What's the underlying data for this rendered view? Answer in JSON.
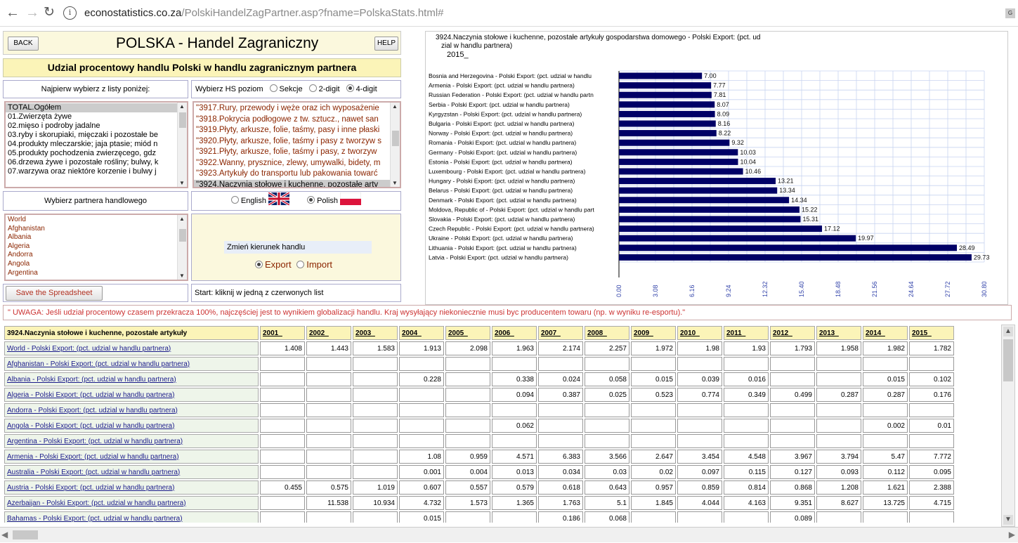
{
  "browser": {
    "url_domain": "econostatistics.co.za",
    "url_path": "/PolskiHandelZagPartner.asp?fname=PolskaStats.html#"
  },
  "header": {
    "back_label": "BACK",
    "title": "POLSKA - Handel Zagraniczny",
    "help_label": "HELP",
    "subtitle": "Udzial procentowy handlu Polski w handlu zagranicznym partnera"
  },
  "selectors": {
    "first_label": "Najpierw wybierz z listy poniżej:",
    "hs_label": "Wybierz HS poziom",
    "hs_options": [
      "Sekcje",
      "2-digit",
      "4-digit"
    ],
    "hs_selected": "4-digit",
    "product_list": [
      "TOTAL.Ogółem",
      "01.Zwierzęta żywe",
      "02.mięso i podroby jadalne",
      "03.ryby i skorupiaki, mięczaki i pozostałe be",
      "04.produkty mleczarskie; jaja ptasie; miód n",
      "05.produkty pochodzenia zwierzęcego, gdz",
      "06.drzewa żywe i pozostałe rośliny; bulwy, k",
      "07.warzywa oraz niektóre korzenie i bulwy j"
    ],
    "hs_list": [
      "\"3917.Rury, przewody i węże oraz ich wyposażenie",
      "\"3918.Pokrycia podłogowe z tw. sztucz., nawet san",
      "\"3919.Płyty, arkusze, folie, taśmy, pasy i inne płaski",
      "\"3920.Płyty, arkusze, folie, taśmy i pasy z tworzyw s",
      "\"3921.Płyty, arkusze, folie, taśmy i pasy, z tworzyw",
      "\"3922.Wanny, prysznice, zlewy, umywalki, bidety, m",
      "\"3923.Artykuły do transportu lub pakowania towarć",
      "\"3924.Naczynia stołowe i kuchenne, pozostałe arty"
    ],
    "partner_label": "Wybierz partnera handlowego",
    "language_options": [
      "English",
      "Polish"
    ],
    "language_selected": "Polish",
    "partner_list": [
      "World",
      "Afghanistan",
      "Albania",
      "Algeria",
      "Andorra",
      "Angola",
      "Argentina"
    ],
    "direction_label": "Zmień kierunek handlu",
    "direction_options": [
      "Export",
      "Import"
    ],
    "direction_selected": "Export",
    "save_label": "Save the Spreadsheet",
    "start_hint": "Start: kliknij w jedną z czerwonych list"
  },
  "chart_data": {
    "type": "bar",
    "orientation": "horizontal",
    "title": "3924.Naczynia stołowe i kuchenne, pozostałe artykuły gospodarstwa domowego  - Polski  Export: (pct. ud",
    "title_line2": "zial  w handlu partnera)",
    "year": "2015_",
    "categories": [
      "Bosnia and Herzegovina - Polski Export: (pct. udzial  w handlu",
      "Armenia - Polski Export: (pct. udzial  w handlu partnera)",
      "Russian Federation - Polski Export: (pct. udzial  w handlu partn",
      "Serbia - Polski Export: (pct. udzial  w handlu partnera)",
      "Kyrgyzstan - Polski Export: (pct. udzial  w handlu partnera)",
      "Bulgaria - Polski Export: (pct. udzial  w handlu partnera)",
      "Norway - Polski Export: (pct. udzial  w handlu partnera)",
      "Romania - Polski Export: (pct. udzial  w handlu partnera)",
      "Germany - Polski Export: (pct. udzial  w handlu partnera)",
      "Estonia - Polski Export: (pct. udzial  w handlu partnera)",
      "Luxembourg - Polski Export: (pct. udzial  w handlu partnera)",
      "Hungary - Polski Export: (pct. udzial  w handlu partnera)",
      "Belarus - Polski Export: (pct. udzial  w handlu partnera)",
      "Denmark - Polski Export: (pct. udzial  w handlu partnera)",
      "Moldova, Republic of - Polski Export: (pct. udzial  w handlu part",
      "Slovakia - Polski Export: (pct. udzial  w handlu partnera)",
      "Czech Republic - Polski Export: (pct. udzial  w handlu partnera)",
      "Ukraine - Polski Export: (pct. udzial  w handlu partnera)",
      "Lithuania - Polski Export: (pct. udzial  w handlu partnera)",
      "Latvia - Polski Export: (pct. udzial  w handlu partnera)"
    ],
    "values": [
      7.0,
      7.77,
      7.81,
      8.07,
      8.09,
      8.16,
      8.22,
      9.32,
      10.03,
      10.04,
      10.46,
      13.21,
      13.34,
      14.34,
      15.22,
      15.31,
      17.12,
      19.97,
      28.49,
      29.73
    ],
    "xticks": [
      "0.00",
      "3.08",
      "6.16",
      "9.24",
      "12.32",
      "15.40",
      "18.48",
      "21.56",
      "24.64",
      "27.72",
      "30.80"
    ],
    "xlim": [
      0,
      30.8
    ],
    "grid": true,
    "bar_color": "#000066"
  },
  "notice": "\" UWAGA: Jeśli udział procentowy czasem przekracza 100%, najczęściej jest to wynikiem globalizacji handlu. Kraj wysyłający niekoniecznie musi byc producentem towaru (np. w wyniku re-esportu).\"",
  "table": {
    "corner": "3924.Naczynia stołowe i kuchenne, pozostałe artykuły",
    "years": [
      "2001_",
      "2002_",
      "2003_",
      "2004_",
      "2005_",
      "2006_",
      "2007_",
      "2008_",
      "2009_",
      "2010_",
      "2011_",
      "2012_",
      "2013_",
      "2014_",
      "2015_"
    ],
    "rows": [
      {
        "label": "World - Polski Export: (pct. udzial w handlu partnera)",
        "values": [
          "1.408",
          "1.443",
          "1.583",
          "1.913",
          "2.098",
          "1.963",
          "2.174",
          "2.257",
          "1.972",
          "1.98",
          "1.93",
          "1.793",
          "1.958",
          "1.982",
          "1.782"
        ]
      },
      {
        "label": "Afghanistan - Polski Export: (pct. udzial w handlu partnera)",
        "values": [
          "",
          "",
          "",
          "",
          "",
          "",
          "",
          "",
          "",
          "",
          "",
          "",
          "",
          "",
          ""
        ]
      },
      {
        "label": "Albania - Polski Export: (pct. udzial w handlu partnera)",
        "values": [
          "",
          "",
          "",
          "0.228",
          "",
          "0.338",
          "0.024",
          "0.058",
          "0.015",
          "0.039",
          "0.016",
          "",
          "",
          "0.015",
          "0.102"
        ]
      },
      {
        "label": "Algeria - Polski Export: (pct. udzial w handlu partnera)",
        "values": [
          "",
          "",
          "",
          "",
          "",
          "0.094",
          "0.387",
          "0.025",
          "0.523",
          "0.774",
          "0.349",
          "0.499",
          "0.287",
          "0.287",
          "0.176"
        ]
      },
      {
        "label": "Andorra - Polski Export: (pct. udzial w handlu partnera)",
        "values": [
          "",
          "",
          "",
          "",
          "",
          "",
          "",
          "",
          "",
          "",
          "",
          "",
          "",
          "",
          ""
        ]
      },
      {
        "label": "Angola - Polski Export: (pct. udzial w handlu partnera)",
        "values": [
          "",
          "",
          "",
          "",
          "",
          "0.062",
          "",
          "",
          "",
          "",
          "",
          "",
          "",
          "0.002",
          "0.01"
        ]
      },
      {
        "label": "Argentina - Polski Export: (pct. udzial w handlu partnera)",
        "values": [
          "",
          "",
          "",
          "",
          "",
          "",
          "",
          "",
          "",
          "",
          "",
          "",
          "",
          "",
          ""
        ]
      },
      {
        "label": "Armenia - Polski Export: (pct. udzial w handlu partnera)",
        "values": [
          "",
          "",
          "",
          "1.08",
          "0.959",
          "4.571",
          "6.383",
          "3.566",
          "2.647",
          "3.454",
          "4.548",
          "3.967",
          "3.794",
          "5.47",
          "7.772"
        ]
      },
      {
        "label": "Australia - Polski Export: (pct. udzial w handlu partnera)",
        "values": [
          "",
          "",
          "",
          "0.001",
          "0.004",
          "0.013",
          "0.034",
          "0.03",
          "0.02",
          "0.097",
          "0.115",
          "0.127",
          "0.093",
          "0.112",
          "0.095"
        ]
      },
      {
        "label": "Austria - Polski Export: (pct. udzial w handlu partnera)",
        "values": [
          "0.455",
          "0.575",
          "1.019",
          "0.607",
          "0.557",
          "0.579",
          "0.618",
          "0.643",
          "0.957",
          "0.859",
          "0.814",
          "0.868",
          "1.208",
          "1.621",
          "2.388"
        ]
      },
      {
        "label": "Azerbaijan - Polski Export: (pct. udzial w handlu partnera)",
        "values": [
          "",
          "11.538",
          "10.934",
          "4.732",
          "1.573",
          "1.365",
          "1.763",
          "5.1",
          "1.845",
          "4.044",
          "4.163",
          "9.351",
          "8.627",
          "13.725",
          "4.715"
        ]
      },
      {
        "label": "Bahamas - Polski Export: (pct. udzial w handlu partnera)",
        "values": [
          "",
          "",
          "",
          "0.015",
          "",
          "",
          "0.186",
          "0.068",
          "",
          "",
          "",
          "0.089",
          "",
          "",
          ""
        ]
      }
    ]
  }
}
